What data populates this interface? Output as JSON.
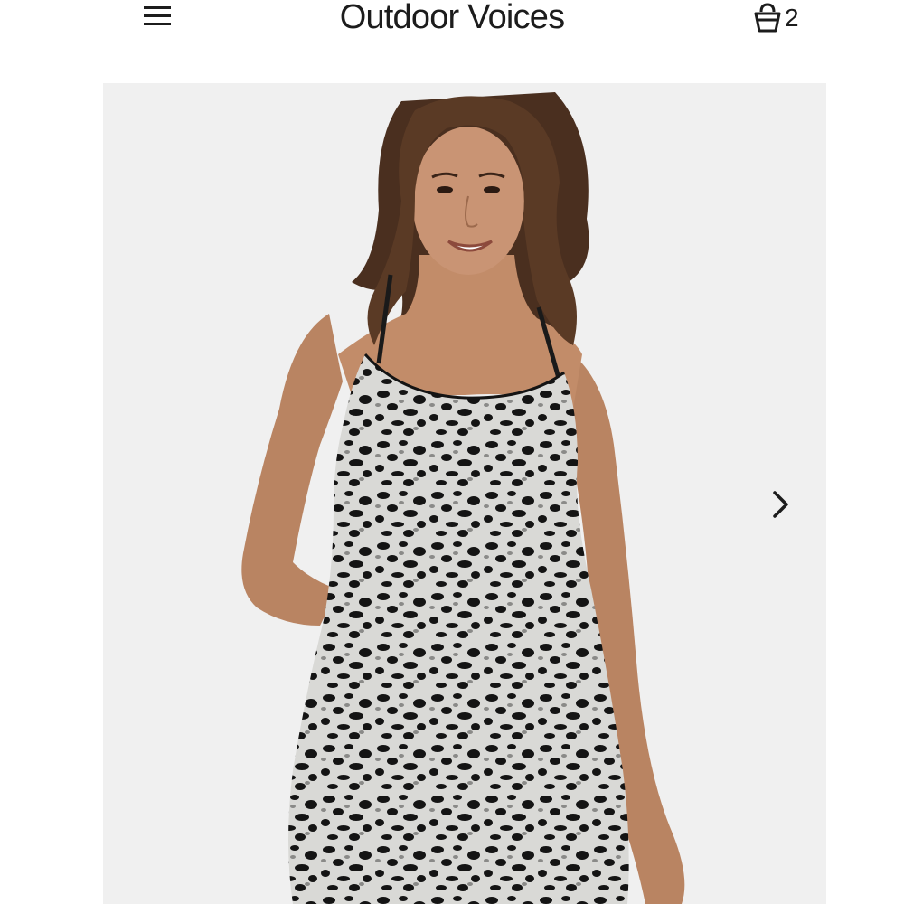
{
  "header": {
    "brand": "Outdoor Voices",
    "menu_icon": "hamburger-menu-icon",
    "cart_icon": "shopping-bag-icon",
    "cart_count": "2"
  },
  "gallery": {
    "image_subject": "model-wearing-leopard-print-dress",
    "next_icon": "chevron-right-icon"
  },
  "colors": {
    "background": "#ffffff",
    "gallery_background": "#f0f0f0",
    "text": "#1c1c1c",
    "print_light": "#d9d9d6",
    "print_dark": "#141414"
  }
}
